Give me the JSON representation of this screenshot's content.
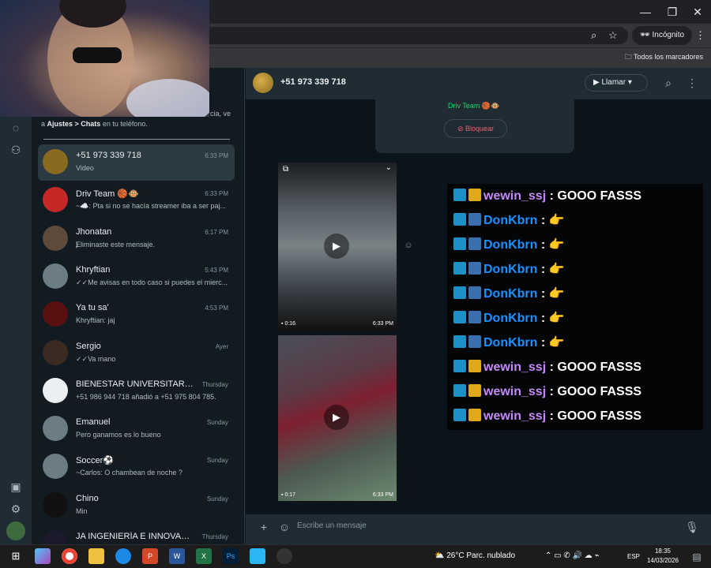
{
  "browser": {
    "incognito_label": "Incógnito",
    "bookmarks_label": "Todos los marcadores",
    "window_buttons": [
      "—",
      "❐",
      "✕"
    ]
  },
  "notice": {
    "text_pre": "a ",
    "bold1": "Ajustes",
    "sep": " > ",
    "bold2": "Chats",
    "text_post": " en tu teléfono.",
    "fragment": "cia, ve"
  },
  "chats": [
    {
      "name": "+51 973 339 718",
      "msg": "Video",
      "time": "6:33 PM",
      "icon": "video-icon"
    },
    {
      "name": "Driv Team 🏀🐵",
      "msg": "~☁️: Pta si no se hacía streamer iba a ser paj...",
      "time": "6:33 PM"
    },
    {
      "name": "Jhonatan",
      "msg": "⃠Eliminaste este mensaje.",
      "time": "6:17 PM"
    },
    {
      "name": "Khryftian",
      "msg": "✓✓Me avisas en todo caso si puedes el mierc...",
      "time": "5:43 PM"
    },
    {
      "name": "Ya tu sa'",
      "msg": "Khryftian: jaj",
      "time": "4:53 PM"
    },
    {
      "name": "Sergio",
      "msg": "✓✓Va mano",
      "time": "Ayer"
    },
    {
      "name": "BIENESTAR UNIVERSITARIO - FA...",
      "msg": "+51 986 944 718 añadió a +51 975 804 785.",
      "time": "Thursday"
    },
    {
      "name": "Emanuel",
      "msg": "Pero ganamos es lo bueno",
      "time": "Sunday"
    },
    {
      "name": "Soccer⚽",
      "msg": "~Carlos: O chambean de noche ?",
      "time": "Sunday"
    },
    {
      "name": "Chino",
      "msg": "Min",
      "time": "Sunday"
    },
    {
      "name": "JA INGENIERÍA E INNOVACIÓN",
      "msg": "",
      "time": "Thursday"
    }
  ],
  "conversation": {
    "title": "+51 973 339 718",
    "call_label": "Llamar",
    "group_name": "Driv Team 🏀🐵",
    "block_label": "Bloquear",
    "videos": [
      {
        "duration": "0:16",
        "time": "6:33 PM"
      },
      {
        "duration": "0:17",
        "time": "6:33 PM"
      }
    ],
    "composer_placeholder": "Escribe un mensaje"
  },
  "overlay_chat": [
    {
      "user": "wewin_ssj",
      "text": "GOOO FASSS",
      "color": "#c58af9",
      "badges": [
        "b1",
        "b2"
      ]
    },
    {
      "user": "DonKbrn",
      "text": "👉",
      "color": "#1e90ff",
      "badges": [
        "b1",
        "b3"
      ]
    },
    {
      "user": "DonKbrn",
      "text": "👉",
      "color": "#1e90ff",
      "badges": [
        "b1",
        "b3"
      ]
    },
    {
      "user": "DonKbrn",
      "text": "👉",
      "color": "#1e90ff",
      "badges": [
        "b1",
        "b3"
      ]
    },
    {
      "user": "DonKbrn",
      "text": "👉",
      "color": "#1e90ff",
      "badges": [
        "b1",
        "b3"
      ]
    },
    {
      "user": "DonKbrn",
      "text": "👉",
      "color": "#1e90ff",
      "badges": [
        "b1",
        "b3"
      ]
    },
    {
      "user": "DonKbrn",
      "text": "👉",
      "color": "#1e90ff",
      "badges": [
        "b1",
        "b3"
      ]
    },
    {
      "user": "wewin_ssj",
      "text": "GOOO FASSS",
      "color": "#c58af9",
      "badges": [
        "b1",
        "b2"
      ]
    },
    {
      "user": "wewin_ssj",
      "text": "GOOO FASSS",
      "color": "#c58af9",
      "badges": [
        "b1",
        "b2"
      ]
    },
    {
      "user": "wewin_ssj",
      "text": "GOOO FASSS",
      "color": "#c58af9",
      "badges": [
        "b1",
        "b2"
      ]
    }
  ],
  "taskbar": {
    "weather": "26°C  Parc. nublado",
    "lang": "ESP",
    "time": "18:35",
    "date": "14/03/2026"
  },
  "colors": {
    "app_bg": "#111b21",
    "panel": "#202c33",
    "accent_green": "#25d366",
    "danger": "#f15c6d"
  }
}
